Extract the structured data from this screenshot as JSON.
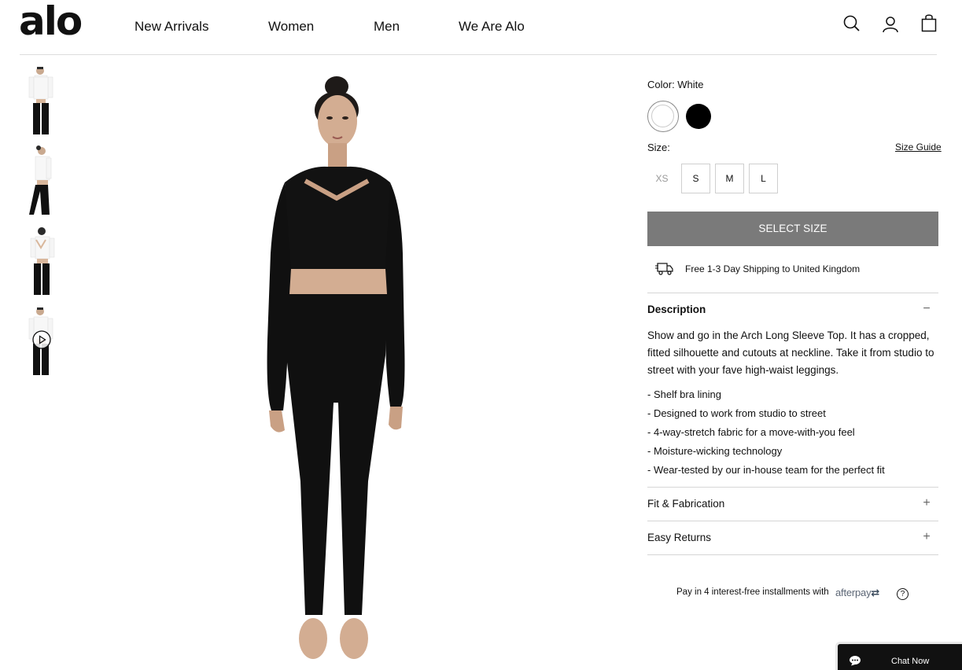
{
  "header": {
    "logo": "alo",
    "nav": [
      "New Arrivals",
      "Women",
      "Men",
      "We Are Alo"
    ]
  },
  "product": {
    "color_label": "Color: White",
    "colors": [
      {
        "name": "White",
        "hex": "#ffffff",
        "selected": true
      },
      {
        "name": "Black",
        "hex": "#000000",
        "selected": false
      }
    ],
    "size_label": "Size:",
    "size_guide": "Size Guide",
    "sizes": [
      {
        "label": "XS",
        "available": false
      },
      {
        "label": "S",
        "available": true
      },
      {
        "label": "M",
        "available": true
      },
      {
        "label": "L",
        "available": true
      }
    ],
    "select_size": "SELECT SIZE",
    "shipping": "Free 1-3 Day Shipping to United Kingdom"
  },
  "description": {
    "title": "Description",
    "toggle": "−",
    "body": "Show and go in the Arch Long Sleeve Top. It has a cropped, fitted silhouette and cutouts at neckline. Take it from studio to street with your fave high-waist leggings.",
    "bullets": [
      "- Shelf bra lining",
      "- Designed to work from studio to street",
      "- 4-way-stretch fabric for a move-with-you feel",
      "- Moisture-wicking technology",
      "- Wear-tested by our in-house team for the perfect fit"
    ]
  },
  "accordions": [
    {
      "title": "Fit & Fabrication",
      "toggle": "+"
    },
    {
      "title": "Easy Returns",
      "toggle": "+"
    }
  ],
  "payment": {
    "text": "Pay in 4 interest-free installments with",
    "brand": "afterpay",
    "help": "?"
  },
  "chat": {
    "label": "Chat Now"
  },
  "colors": {
    "button_gray": "#7a7a7a",
    "rule": "#d6d6d6",
    "chat_bg": "#111111",
    "afterpay": "#5d6776"
  }
}
